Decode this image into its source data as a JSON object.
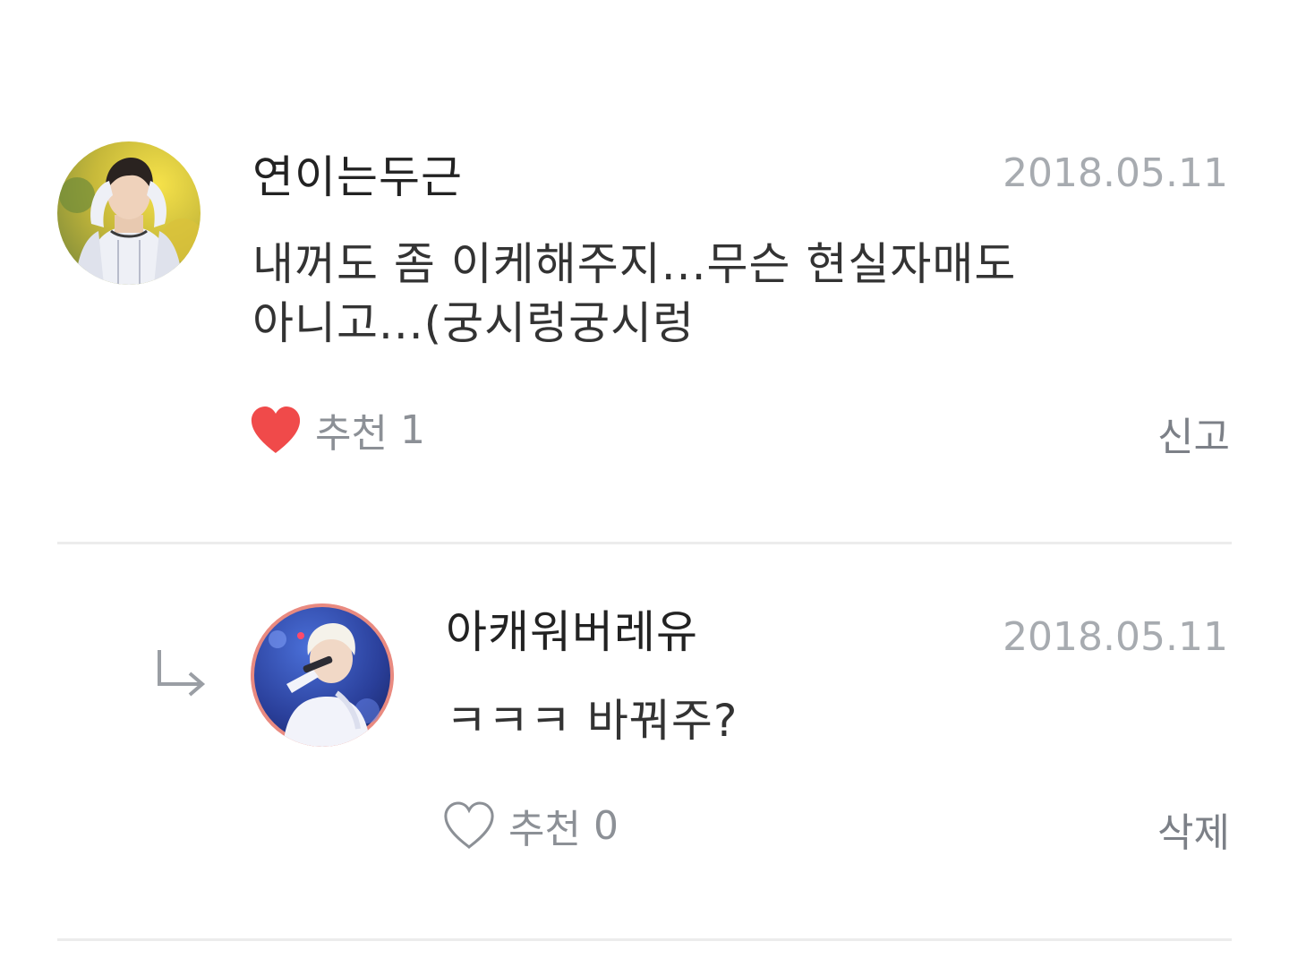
{
  "comments": [
    {
      "username": "연이는두근",
      "date": "2018.05.11",
      "body_lines": [
        "내꺼도 좀 이케해주지...무슨 현실자매도",
        "아니고...(궁시렁궁시렁"
      ],
      "like_label": "추천",
      "like_count": "1",
      "liked": true,
      "action_label": "신고",
      "avatar_icon": "profile-photo"
    },
    {
      "is_reply": true,
      "reply_icon": "reply-arrow-icon",
      "username": "아캐워버레유",
      "date": "2018.05.11",
      "body_lines": [
        "ㅋㅋㅋ 바꿔주?"
      ],
      "like_label": "추천",
      "like_count": "0",
      "liked": false,
      "action_label": "삭제",
      "avatar_icon": "profile-photo"
    }
  ],
  "colors": {
    "heart_filled": "#f04a4a",
    "heart_outline": "#8c9096",
    "date": "#a7abb0",
    "divider": "#ececec",
    "avatar_ring": "#e98a80"
  }
}
